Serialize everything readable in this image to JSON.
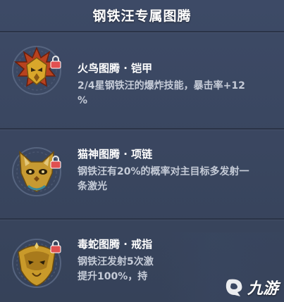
{
  "header": {
    "title": "钢铁汪专属图腾"
  },
  "items": [
    {
      "name": "火鸟图腾 · 铠甲",
      "desc_lines": [
        "2/4星钢铁汪的爆炸技能，暴击率+12",
        "%"
      ],
      "emblem": "firebird-totem-icon",
      "locked": true
    },
    {
      "name": "猫神图腾 · 项链",
      "desc_lines": [
        "钢铁汪有20%的概率对主目标多发射一",
        "条激光"
      ],
      "emblem": "cat-god-totem-icon",
      "locked": true
    },
    {
      "name": "毒蛇图腾 · 戒指",
      "desc_lines": [
        "钢铁汪发射5次激",
        "提升100%，持"
      ],
      "emblem": "viper-totem-icon",
      "locked": true
    }
  ],
  "watermark": {
    "text": "九游",
    "icon": "jiuyou-logo-icon"
  },
  "colors": {
    "background": "#3a4761",
    "gold": "#d9a72b",
    "lock": "#e05050"
  }
}
